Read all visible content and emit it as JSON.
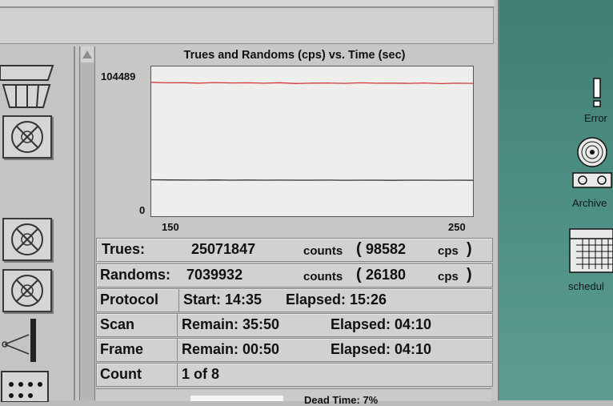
{
  "chart": {
    "title": "Trues and Randoms (cps) vs. Time (sec)",
    "y_top_label": "104489",
    "y_bottom_label": "0",
    "x_left_label": "150",
    "x_right_label": "250"
  },
  "chart_data": {
    "type": "line",
    "title": "Trues and Randoms (cps) vs. Time (sec)",
    "xlabel": "",
    "ylabel": "",
    "xlim": [
      150,
      250
    ],
    "ylim": [
      0,
      104489
    ],
    "grid": false,
    "x": [
      150,
      155,
      160,
      165,
      170,
      175,
      180,
      185,
      190,
      195,
      200,
      205,
      210,
      215,
      220,
      225,
      230,
      235,
      240,
      245,
      250
    ],
    "series": [
      {
        "color": "#d23a3a",
        "values": [
          98700,
          98300,
          98400,
          98100,
          98500,
          98200,
          98300,
          98000,
          98400,
          97800,
          98100,
          98200,
          97900,
          98300,
          98000,
          98100,
          97900,
          98200,
          97700,
          98000,
          97900
        ]
      },
      {
        "color": "#333333",
        "values": [
          26400,
          26300,
          26250,
          26200,
          26300,
          26150,
          26250,
          26100,
          26200,
          26100,
          26150,
          26200,
          26050,
          26150,
          26100,
          26000,
          26150,
          26100,
          26050,
          26100,
          26000
        ]
      }
    ]
  },
  "stats": {
    "trues_label": "Trues:",
    "trues_counts": "25071847",
    "trues_counts_unit": "counts",
    "trues_cps": "98582",
    "trues_cps_unit": "cps",
    "randoms_label": "Randoms:",
    "randoms_counts": "7039932",
    "randoms_counts_unit": "counts",
    "randoms_cps": "26180",
    "randoms_cps_unit": "cps",
    "open_paren": "(",
    "close_paren": ")"
  },
  "protocol": {
    "label": "Protocol",
    "start": "Start: 14:35",
    "elapsed": "Elapsed: 15:26"
  },
  "scan": {
    "label": "Scan",
    "remain": "Remain: 35:50",
    "elapsed": "Elapsed: 04:10"
  },
  "frame": {
    "label": "Frame",
    "remain": "Remain: 00:50",
    "elapsed": "Elapsed: 04:10"
  },
  "count": {
    "label": "Count",
    "value": "1 of 8"
  },
  "footer": {
    "dead_time": "Dead Time: 7%"
  },
  "desktop": {
    "error_label": "Error",
    "archive_label": "Archive",
    "schedule_label": "schedul"
  }
}
